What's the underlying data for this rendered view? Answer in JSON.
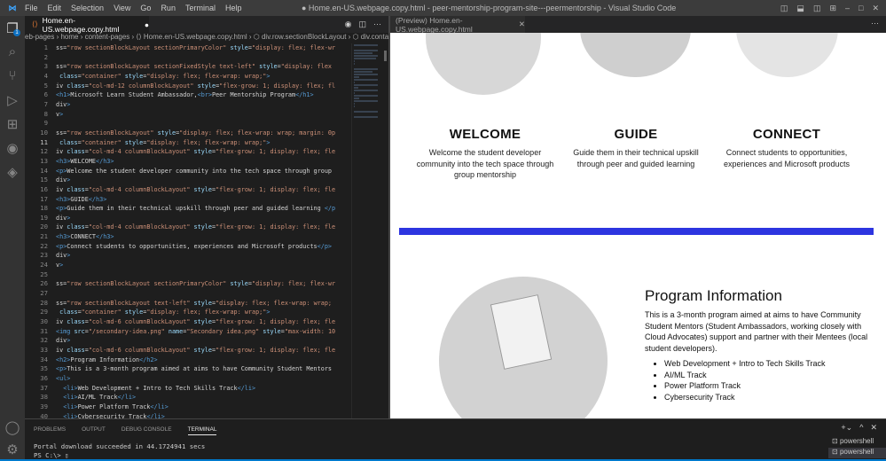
{
  "menu": [
    "File",
    "Edit",
    "Selection",
    "View",
    "Go",
    "Run",
    "Terminal",
    "Help"
  ],
  "window_title": "● Home.en-US.webpage.copy.html - peer-mentorship-program-site---peermentorship - Visual Studio Code",
  "explorer_badge": "1",
  "editor": {
    "tab": "Home.en-US.webpage.copy.html",
    "modified": "●",
    "breadcrumb": "eb-pages › home › content-pages › ⟨⟩ Home.en-US.webpage.copy.html › ⬡ div.row.sectionBlockLayout › ⬡ div.container",
    "current_line": 11,
    "lines": [
      "ss=\"row sectionBlockLayout sectionPrimaryColor\" style=\"display: flex; flex-wr",
      "",
      "ss=\"row sectionBlockLayout sectionFixedStyle text-left\" style=\"display: flex",
      " class=\"container\" style=\"display: flex; flex-wrap: wrap;\">",
      "iv class=\"col-md-12 columnBlockLayout\" style=\"flex-grow: 1; display: flex; fl",
      "<h1>Microsoft Learn Student Ambassador,<br>Peer Mentorship Program</h1>",
      "div>",
      "v>",
      "",
      "ss=\"row sectionBlockLayout\" style=\"display: flex; flex-wrap: wrap; margin: 0p",
      " class=\"container\" style=\"display: flex; flex-wrap: wrap;\">",
      "iv class=\"col-md-4 columnBlockLayout\" style=\"flex-grow: 1; display: flex; fle",
      "<h3>WELCOME</h3>",
      "<p>Welcome the student developer community into the tech space through group",
      "div>",
      "iv class=\"col-md-4 columnBlockLayout\" style=\"flex-grow: 1; display: flex; fle",
      "<h3>GUIDE</h3>",
      "<p>Guide them in their technical upskill through peer and guided learning </p",
      "div>",
      "iv class=\"col-md-4 columnBlockLayout\" style=\"flex-grow: 1; display: flex; fle",
      "<h3>CONNECT</h3>",
      "<p>Connect students to opportunities, experiences and Microsoft products</p>",
      "div>",
      "v>",
      "",
      "ss=\"row sectionBlockLayout sectionPrimaryColor\" style=\"display: flex; flex-wr",
      "",
      "ss=\"row sectionBlockLayout text-left\" style=\"display: flex; flex-wrap: wrap;",
      " class=\"container\" style=\"display: flex; flex-wrap: wrap;\">",
      "iv class=\"col-md-6 columnBlockLayout\" style=\"flex-grow: 1; display: flex; fle",
      "<img src=\"/secondary-idea.png\" name=\"Secondary idea.png\" style=\"max-width: 10",
      "div>",
      "iv class=\"col-md-6 columnBlockLayout\" style=\"flex-grow: 1; display: flex; fle",
      "<h2>Program Information</h2>",
      "<p>This is a 3-month program aimed at aims to have Community Student Mentors",
      "<ul>",
      "  <li>Web Development + Intro to Tech Skills Track</li>",
      "  <li>AI/ML Track</li>",
      "  <li>Power Platform Track</li>",
      "  <li>Cybersecurity Track</li>"
    ]
  },
  "preview": {
    "tab": "(Preview) Home.en-US.webpage.copy.html",
    "columns": [
      {
        "title": "WELCOME",
        "text": "Welcome the student developer community into the tech space through group mentorship"
      },
      {
        "title": "GUIDE",
        "text": "Guide them in their technical upskill through peer and guided learning"
      },
      {
        "title": "CONNECT",
        "text": "Connect students to opportunities, experiences and Microsoft products"
      }
    ],
    "accent": "#2d35e0",
    "program": {
      "title": "Program Information",
      "text": "This is a 3-month program aimed at aims to have Community Student Mentors (Student Ambassadors, working closely with Cloud Advocates) support and partner with their Mentees (local student developers).",
      "tracks": [
        "Web Development + Intro to Tech Skills Track",
        "AI/ML Track",
        "Power Platform Track",
        "Cybersecurity Track"
      ]
    }
  },
  "panel": {
    "tabs": [
      "PROBLEMS",
      "OUTPUT",
      "DEBUG CONSOLE",
      "TERMINAL"
    ],
    "terminal": [
      "Portal download succeeded in 44.1724941 secs",
      "PS C:\\> ▯"
    ],
    "terminals": [
      "powershell",
      "powershell"
    ]
  }
}
